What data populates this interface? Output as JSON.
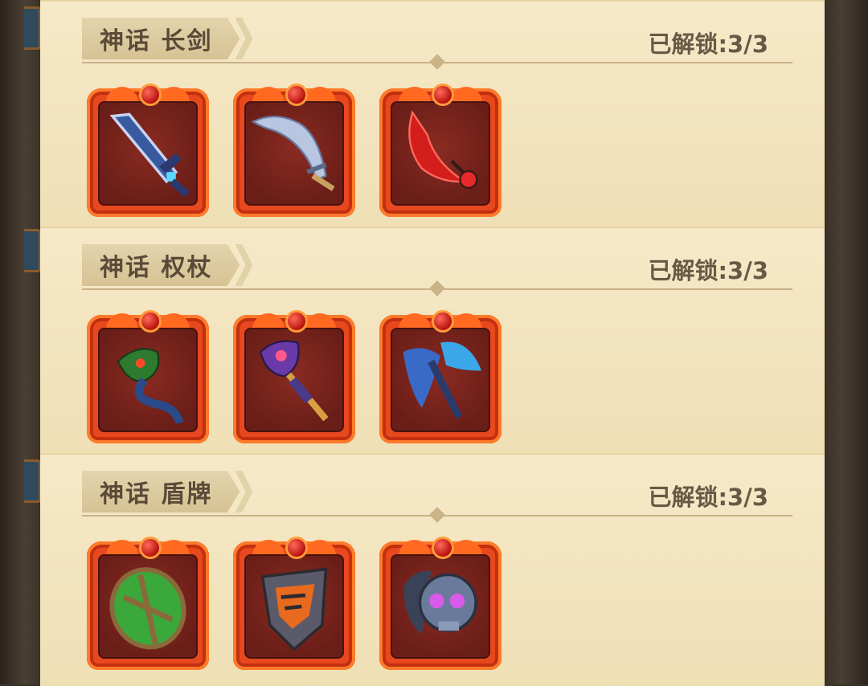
{
  "sections": [
    {
      "title": "神话 长剑",
      "unlock": "已解锁:3/3",
      "items": [
        {
          "icon": "blue-sword-icon",
          "color": "#4a6fb8"
        },
        {
          "icon": "scimitar-icon",
          "color": "#b9c6e2"
        },
        {
          "icon": "red-blade-icon",
          "color": "#d41e1e"
        }
      ]
    },
    {
      "title": "神话 权杖",
      "unlock": "已解锁:3/3",
      "items": [
        {
          "icon": "dragon-staff-icon",
          "color": "#3a8a3a"
        },
        {
          "icon": "purple-scepter-icon",
          "color": "#7a4ab8"
        },
        {
          "icon": "blue-wing-staff-icon",
          "color": "#3a7ad8"
        }
      ]
    },
    {
      "title": "神话 盾牌",
      "unlock": "已解锁:3/3",
      "items": [
        {
          "icon": "green-shield-icon",
          "color": "#3aa83a"
        },
        {
          "icon": "orange-armor-shield-icon",
          "color": "#e86a1e"
        },
        {
          "icon": "skull-shield-icon",
          "color": "#5a6a8a"
        }
      ]
    }
  ]
}
